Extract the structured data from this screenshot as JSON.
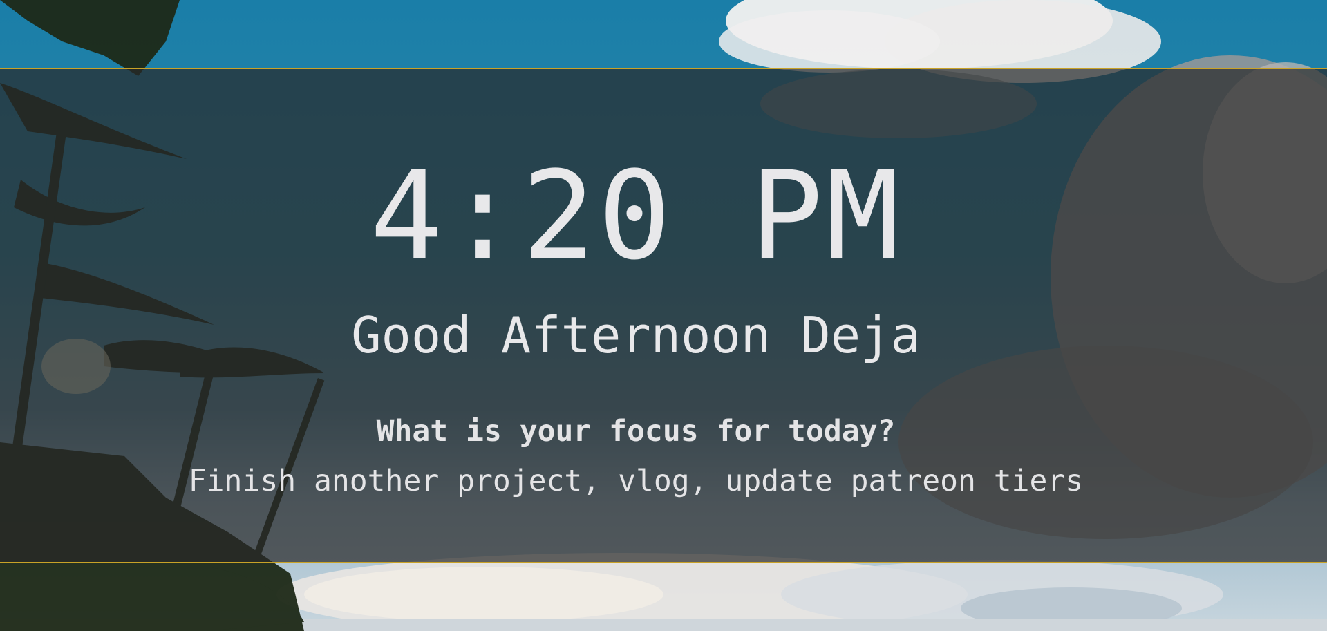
{
  "clock": {
    "time": "4:20 PM"
  },
  "greeting": {
    "text": "Good Afternoon Deja"
  },
  "focus": {
    "question": "What is your focus for today?",
    "answer": "Finish another project, vlog, update patreon tiers"
  },
  "colors": {
    "overlay": "#282828",
    "overlay_border": "#c9a227",
    "text": "#e8e8ea",
    "sky": "#1a7ea8"
  },
  "background": {
    "scene": "tropical beach with palm trees and clouds"
  }
}
